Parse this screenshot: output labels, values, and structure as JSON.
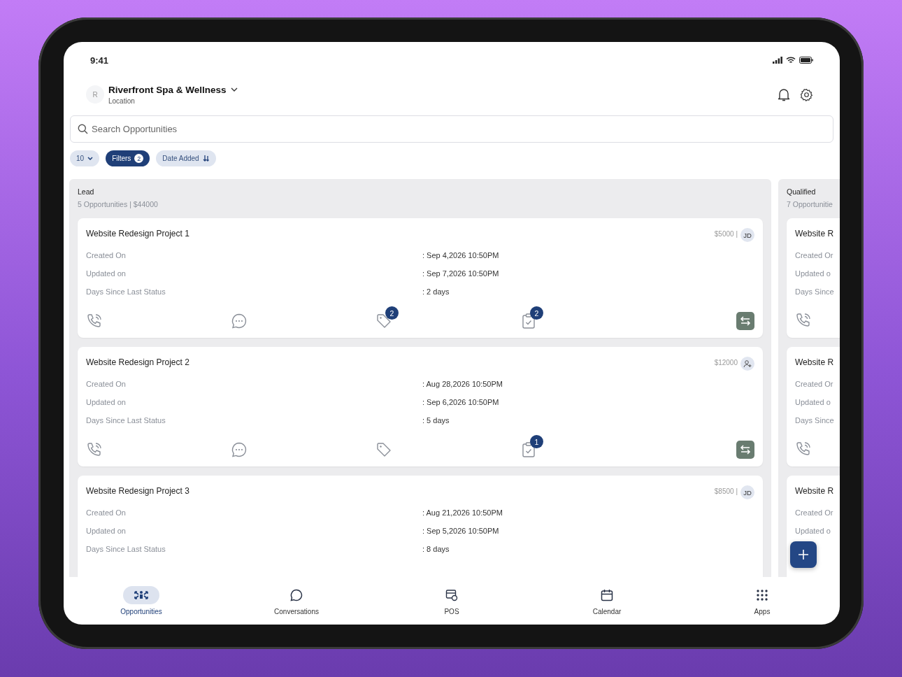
{
  "status_bar": {
    "time": "9:41"
  },
  "header": {
    "avatar": "R",
    "business": "Riverfront Spa & Wellness",
    "subtitle": "Location"
  },
  "search": {
    "placeholder": "Search Opportunities"
  },
  "chips": [
    {
      "kind": "page_size",
      "label": "10"
    },
    {
      "kind": "filters",
      "label": "Filters",
      "count": "2"
    },
    {
      "kind": "sort",
      "label": "Date Added"
    }
  ],
  "columns": [
    {
      "name": "Lead",
      "summary": "5 Opportunities | $44000",
      "cards": [
        {
          "title": "Website Redesign Project 1",
          "amount": "$5000 |",
          "owner": {
            "kind": "initials",
            "text": "JD"
          },
          "fields": [
            {
              "label": "Created On",
              "value": ": Sep 4,2026 10:50PM"
            },
            {
              "label": "Updated on",
              "value": ": Sep 7,2026 10:50PM"
            },
            {
              "label": "Days Since Last Status",
              "value": ": 2 days"
            }
          ],
          "actions": [
            {
              "kind": "call"
            },
            {
              "kind": "message"
            },
            {
              "kind": "tag",
              "badge": "2"
            },
            {
              "kind": "task",
              "badge": "2"
            },
            {
              "kind": "move"
            }
          ]
        },
        {
          "title": "Website Redesign Project 2",
          "amount": "$12000",
          "owner": {
            "kind": "add"
          },
          "fields": [
            {
              "label": "Created On",
              "value": ": Aug 28,2026 10:50PM"
            },
            {
              "label": "Updated on",
              "value": ": Sep 6,2026 10:50PM"
            },
            {
              "label": "Days Since Last Status",
              "value": ": 5 days"
            }
          ],
          "actions": [
            {
              "kind": "call"
            },
            {
              "kind": "message"
            },
            {
              "kind": "tag"
            },
            {
              "kind": "task",
              "badge": "1"
            },
            {
              "kind": "move"
            }
          ]
        },
        {
          "title": "Website Redesign Project 3",
          "amount": "$8500 |",
          "owner": {
            "kind": "initials",
            "text": "JD"
          },
          "fields": [
            {
              "label": "Created On",
              "value": ": Aug 21,2026 10:50PM"
            },
            {
              "label": "Updated on",
              "value": ": Sep 5,2026 10:50PM"
            },
            {
              "label": "Days Since Last Status",
              "value": ": 8 days"
            }
          ]
        }
      ]
    },
    {
      "name": "Qualified",
      "summary": "7 Opportunitie",
      "cards": [
        {
          "title": "Website R",
          "fields": [
            {
              "label": "Created Or"
            },
            {
              "label": "Updated o"
            },
            {
              "label": "Days Since"
            }
          ],
          "actions": [
            {
              "kind": "call"
            }
          ]
        },
        {
          "title": "Website R",
          "fields": [
            {
              "label": "Created Or"
            },
            {
              "label": "Updated o"
            },
            {
              "label": "Days Since"
            }
          ],
          "actions": [
            {
              "kind": "call"
            }
          ]
        },
        {
          "title": "Website R",
          "fields": [
            {
              "label": "Created Or"
            },
            {
              "label": "Updated o"
            }
          ]
        }
      ]
    }
  ],
  "tabs": [
    {
      "kind": "opportunities",
      "label": "Opportunities",
      "selected": true
    },
    {
      "kind": "conversations",
      "label": "Conversations",
      "selected": false
    },
    {
      "kind": "pos",
      "label": "POS",
      "selected": false
    },
    {
      "kind": "calendar",
      "label": "Calendar",
      "selected": false
    },
    {
      "kind": "apps",
      "label": "Apps",
      "selected": false
    }
  ]
}
